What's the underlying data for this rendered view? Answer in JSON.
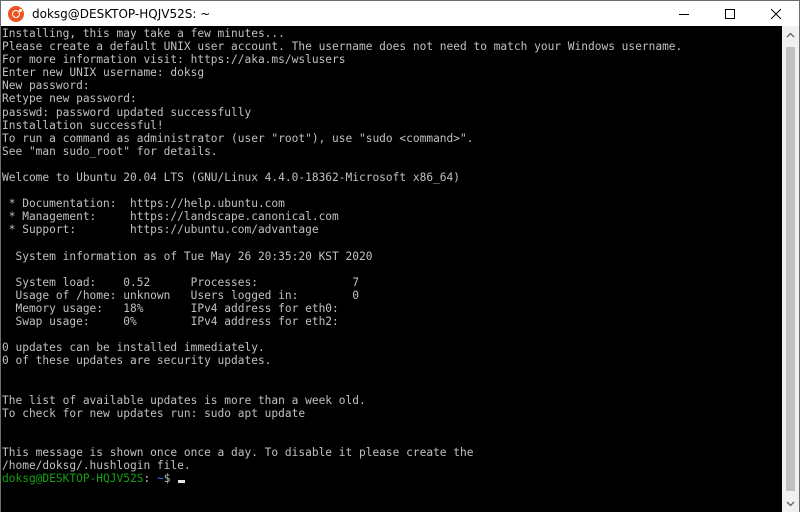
{
  "window": {
    "title": "doksg@DESKTOP-HQJV52S: ~",
    "controls": {
      "minimize": "minimize-icon",
      "maximize": "maximize-icon",
      "close": "close-icon"
    }
  },
  "terminal": {
    "lines": [
      "Installing, this may take a few minutes...",
      "Please create a default UNIX user account. The username does not need to match your Windows username.",
      "For more information visit: https://aka.ms/wslusers",
      "Enter new UNIX username: doksg",
      "New password:",
      "Retype new password:",
      "passwd: password updated successfully",
      "Installation successful!",
      "To run a command as administrator (user \"root\"), use \"sudo <command>\".",
      "See \"man sudo_root\" for details.",
      "",
      "Welcome to Ubuntu 20.04 LTS (GNU/Linux 4.4.0-18362-Microsoft x86_64)",
      "",
      " * Documentation:  https://help.ubuntu.com",
      " * Management:     https://landscape.canonical.com",
      " * Support:        https://ubuntu.com/advantage",
      "",
      "  System information as of Tue May 26 20:35:20 KST 2020",
      "",
      "  System load:    0.52      Processes:              7",
      "  Usage of /home: unknown   Users logged in:        0",
      "  Memory usage:   18%       IPv4 address for eth0:",
      "  Swap usage:     0%        IPv4 address for eth2:",
      "",
      "0 updates can be installed immediately.",
      "0 of these updates are security updates.",
      "",
      "",
      "The list of available updates is more than a week old.",
      "To check for new updates run: sudo apt update",
      "",
      "",
      "This message is shown once once a day. To disable it please create the",
      "/home/doksg/.hushlogin file."
    ],
    "prompt": {
      "user_host": "doksg@DESKTOP-HQJV52S",
      "separator": ":",
      "path": " ~",
      "symbol": "$ "
    }
  },
  "colors": {
    "background": "#000000",
    "text": "#c0c0c0",
    "prompt_user": "#13a10e",
    "prompt_path": "#3b78ff"
  }
}
